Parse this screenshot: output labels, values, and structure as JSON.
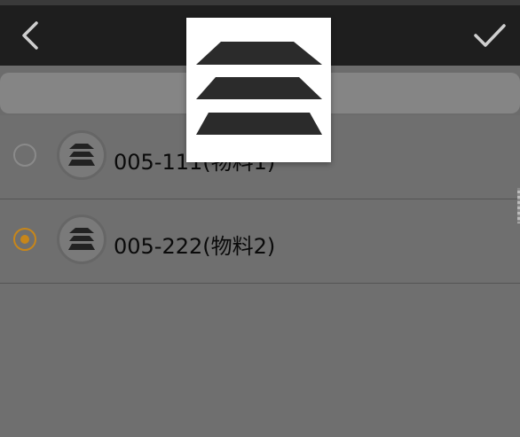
{
  "header": {
    "back_icon": "chevron-left-icon",
    "confirm_icon": "checkmark-icon"
  },
  "search": {
    "placeholder": ""
  },
  "list": {
    "items": [
      {
        "label": "005-111(物料1)",
        "selected": false,
        "icon": "layers-icon"
      },
      {
        "label": "005-222(物料2)",
        "selected": true,
        "icon": "layers-icon"
      }
    ]
  },
  "popup": {
    "icon": "layers-icon"
  },
  "colors": {
    "topbar": "#1e1e1e",
    "overlay": "#6f6f6f",
    "accent": "#c7861a",
    "popup_bg": "#ffffff"
  }
}
